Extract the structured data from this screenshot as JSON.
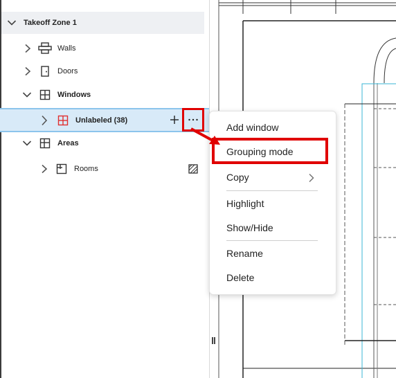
{
  "tree": {
    "zone_label": "Takeoff Zone 1",
    "items": {
      "walls": "Walls",
      "doors": "Doors",
      "windows": "Windows",
      "unlabeled": "Unlabeled (38)",
      "areas": "Areas",
      "rooms": "Rooms"
    }
  },
  "context_menu": {
    "add_window": "Add window",
    "grouping_mode": "Grouping mode",
    "copy": "Copy",
    "highlight": "Highlight",
    "show_hide": "Show/Hide",
    "rename": "Rename",
    "delete": "Delete"
  },
  "colors": {
    "annotation": "#e00000",
    "selection_bg": "#d8eaf8",
    "selection_border": "#8cc4ec",
    "window_icon": "#e03030"
  },
  "icons": [
    "chevron-down-icon",
    "chevron-right-icon",
    "wall-icon",
    "door-icon",
    "window-icon",
    "area-icon",
    "room-icon",
    "plus-icon",
    "more-icon",
    "hatch-icon",
    "arrow-annotation"
  ]
}
